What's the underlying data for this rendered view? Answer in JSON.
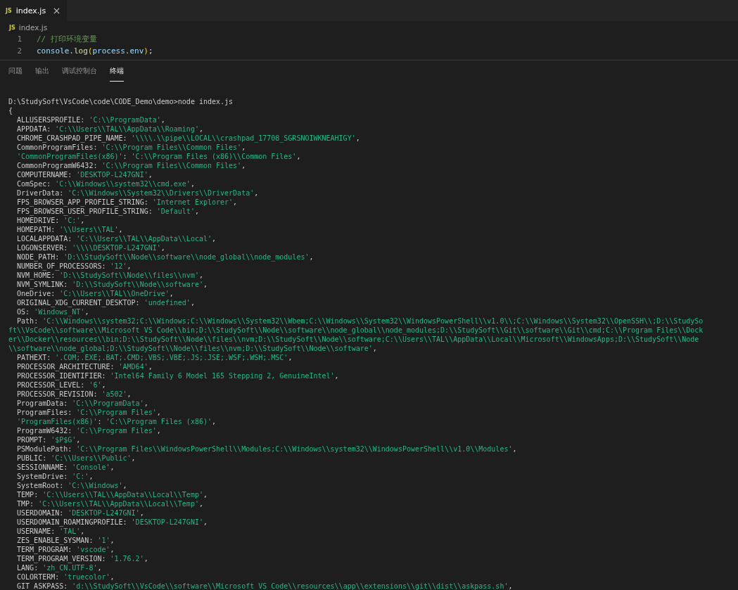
{
  "tabs": [
    {
      "icon_text": "JS",
      "label": "index.js",
      "selected": true
    }
  ],
  "breadcrumb": {
    "icon_text": "JS",
    "label": "index.js"
  },
  "code_lines": [
    {
      "number": "1",
      "tokens": [
        {
          "kind": "comment",
          "text": "// 打印环境变量"
        }
      ]
    },
    {
      "number": "2",
      "tokens": [
        {
          "kind": "variable",
          "text": "console"
        },
        {
          "kind": "punct",
          "text": "."
        },
        {
          "kind": "function",
          "text": "log"
        },
        {
          "kind": "bracket",
          "text": "("
        },
        {
          "kind": "variable",
          "text": "process"
        },
        {
          "kind": "punct",
          "text": "."
        },
        {
          "kind": "variable",
          "text": "env"
        },
        {
          "kind": "bracket",
          "text": ")"
        },
        {
          "kind": "punct",
          "text": ";"
        }
      ]
    }
  ],
  "panel_tabs": [
    {
      "label": "问题",
      "selected": false
    },
    {
      "label": "输出",
      "selected": false
    },
    {
      "label": "调试控制台",
      "selected": false
    },
    {
      "label": "终端",
      "selected": true
    }
  ],
  "terminal": {
    "lines": [
      {
        "kind": "text",
        "text": "D:\\StudySoft\\VsCode\\code\\CODE_Demo\\demo>node index.js"
      },
      {
        "kind": "text",
        "text": "{"
      },
      {
        "kind": "entry",
        "key": "ALLUSERSPROFILE",
        "sep": ":",
        "value": "'C:\\\\ProgramData'",
        "end": ","
      },
      {
        "kind": "entry",
        "key": "APPDATA",
        "sep": ":",
        "value": "'C:\\\\Users\\\\TAL\\\\AppData\\\\Roaming'",
        "end": ","
      },
      {
        "kind": "entry",
        "key": "CHROME_CRASHPAD_PIPE_NAME",
        "sep": ":",
        "value": "'\\\\\\\\.\\\\pipe\\\\LOCAL\\\\crashpad_17708_SGRSNOIWKNEAHIGY'",
        "end": ","
      },
      {
        "kind": "entry",
        "key": "CommonProgramFiles",
        "sep": ":",
        "value": "'C:\\\\Program Files\\\\Common Files'",
        "end": ","
      },
      {
        "kind": "quoted_entry",
        "key": "'CommonProgramFiles(x86)'",
        "sep": ":",
        "value": "'C:\\\\Program Files (x86)\\\\Common Files'",
        "end": ","
      },
      {
        "kind": "entry",
        "key": "CommonProgramW6432",
        "sep": ":",
        "value": "'C:\\\\Program Files\\\\Common Files'",
        "end": ","
      },
      {
        "kind": "entry",
        "key": "COMPUTERNAME",
        "sep": ":",
        "value": "'DESKTOP-L247GNI'",
        "end": ","
      },
      {
        "kind": "entry",
        "key": "ComSpec",
        "sep": ":",
        "value": "'C:\\\\Windows\\\\system32\\\\cmd.exe'",
        "end": ","
      },
      {
        "kind": "entry",
        "key": "DriverData",
        "sep": ":",
        "value": "'C:\\\\Windows\\\\System32\\\\Drivers\\\\DriverData'",
        "end": ","
      },
      {
        "kind": "entry",
        "key": "FPS_BROWSER_APP_PROFILE_STRING",
        "sep": ":",
        "value": "'Internet Explorer'",
        "end": ","
      },
      {
        "kind": "entry",
        "key": "FPS_BROWSER_USER_PROFILE_STRING",
        "sep": ":",
        "value": "'Default'",
        "end": ","
      },
      {
        "kind": "entry",
        "key": "HOMEDRIVE",
        "sep": ":",
        "value": "'C:'",
        "end": ","
      },
      {
        "kind": "entry",
        "key": "HOMEPATH",
        "sep": ":",
        "value": "'\\\\Users\\\\TAL'",
        "end": ","
      },
      {
        "kind": "entry",
        "key": "LOCALAPPDATA",
        "sep": ":",
        "value": "'C:\\\\Users\\\\TAL\\\\AppData\\\\Local'",
        "end": ","
      },
      {
        "kind": "entry",
        "key": "LOGONSERVER",
        "sep": ":",
        "value": "'\\\\\\\\DESKTOP-L247GNI'",
        "end": ","
      },
      {
        "kind": "entry",
        "key": "NODE_PATH",
        "sep": ":",
        "value": "'D:\\\\StudySoft\\\\Node\\\\software\\\\node_global\\\\node_modules'",
        "end": ","
      },
      {
        "kind": "entry",
        "key": "NUMBER_OF_PROCESSORS",
        "sep": ":",
        "value": "'12'",
        "end": ","
      },
      {
        "kind": "entry",
        "key": "NVM_HOME",
        "sep": ":",
        "value": "'D:\\\\StudySoft\\\\Node\\\\files\\\\nvm'",
        "end": ","
      },
      {
        "kind": "entry",
        "key": "NVM_SYMLINK",
        "sep": ":",
        "value": "'D:\\\\StudySoft\\\\Node\\\\software'",
        "end": ","
      },
      {
        "kind": "entry",
        "key": "OneDrive",
        "sep": ":",
        "value": "'C:\\\\Users\\\\TAL\\\\OneDrive'",
        "end": ","
      },
      {
        "kind": "entry",
        "key": "ORIGINAL_XDG_CURRENT_DESKTOP",
        "sep": ":",
        "value": "'undefined'",
        "end": ","
      },
      {
        "kind": "entry",
        "key": "OS",
        "sep": ":",
        "value": "'Windows_NT'",
        "end": ","
      },
      {
        "kind": "entry",
        "key": "Path",
        "sep": ":",
        "value": "'C:\\\\Windows\\\\system32;C:\\\\Windows;C:\\\\Windows\\\\System32\\\\Wbem;C:\\\\Windows\\\\System32\\\\WindowsPowerShell\\\\v1.0\\\\;C:\\\\Windows\\\\System32\\\\OpenSSH\\\\;D:\\\\StudySoft\\\\VsCode\\\\software\\\\Microsoft VS Code\\\\bin;D:\\\\StudySoft\\\\Node\\\\software\\\\node_global\\\\node_modules;D:\\\\StudySoft\\\\Git\\\\software\\\\Git\\\\cmd;C:\\\\Program Files\\\\Docker\\\\Docker\\\\resources\\\\bin;D:\\\\StudySoft\\\\Node\\\\files\\\\nvm;D:\\\\StudySoft\\\\Node\\\\software;C:\\\\Users\\\\TAL\\\\AppData\\\\Local\\\\Microsoft\\\\WindowsApps;D:\\\\StudySoft\\\\Node\\\\software\\\\node_global;D:\\\\StudySoft\\\\Node\\\\files\\\\nvm;D:\\\\StudySoft\\\\Node\\\\software'",
        "end": ","
      },
      {
        "kind": "entry",
        "key": "PATHEXT",
        "sep": ":",
        "value": "'.COM;.EXE;.BAT;.CMD;.VBS;.VBE;.JS;.JSE;.WSF;.WSH;.MSC'",
        "end": ","
      },
      {
        "kind": "entry",
        "key": "PROCESSOR_ARCHITECTURE",
        "sep": ":",
        "value": "'AMD64'",
        "end": ","
      },
      {
        "kind": "entry",
        "key": "PROCESSOR_IDENTIFIER",
        "sep": ":",
        "value": "'Intel64 Family 6 Model 165 Stepping 2, GenuineIntel'",
        "end": ","
      },
      {
        "kind": "entry",
        "key": "PROCESSOR_LEVEL",
        "sep": ":",
        "value": "'6'",
        "end": ","
      },
      {
        "kind": "entry",
        "key": "PROCESSOR_REVISION",
        "sep": ":",
        "value": "'a502'",
        "end": ","
      },
      {
        "kind": "entry",
        "key": "ProgramData",
        "sep": ":",
        "value": "'C:\\\\ProgramData'",
        "end": ","
      },
      {
        "kind": "entry",
        "key": "ProgramFiles",
        "sep": ":",
        "value": "'C:\\\\Program Files'",
        "end": ","
      },
      {
        "kind": "quoted_entry",
        "key": "'ProgramFiles(x86)'",
        "sep": ":",
        "value": "'C:\\\\Program Files (x86)'",
        "end": ","
      },
      {
        "kind": "entry",
        "key": "ProgramW6432",
        "sep": ":",
        "value": "'C:\\\\Program Files'",
        "end": ","
      },
      {
        "kind": "entry",
        "key": "PROMPT",
        "sep": ":",
        "value": "'$P$G'",
        "end": ","
      },
      {
        "kind": "entry",
        "key": "PSModulePath",
        "sep": ":",
        "value": "'C:\\\\Program Files\\\\WindowsPowerShell\\\\Modules;C:\\\\Windows\\\\system32\\\\WindowsPowerShell\\\\v1.0\\\\Modules'",
        "end": ","
      },
      {
        "kind": "entry",
        "key": "PUBLIC",
        "sep": ":",
        "value": "'C:\\\\Users\\\\Public'",
        "end": ","
      },
      {
        "kind": "entry",
        "key": "SESSIONNAME",
        "sep": ":",
        "value": "'Console'",
        "end": ","
      },
      {
        "kind": "entry",
        "key": "SystemDrive",
        "sep": ":",
        "value": "'C:'",
        "end": ","
      },
      {
        "kind": "entry",
        "key": "SystemRoot",
        "sep": ":",
        "value": "'C:\\\\Windows'",
        "end": ","
      },
      {
        "kind": "entry",
        "key": "TEMP",
        "sep": ":",
        "value": "'C:\\\\Users\\\\TAL\\\\AppData\\\\Local\\\\Temp'",
        "end": ","
      },
      {
        "kind": "entry",
        "key": "TMP",
        "sep": ":",
        "value": "'C:\\\\Users\\\\TAL\\\\AppData\\\\Local\\\\Temp'",
        "end": ","
      },
      {
        "kind": "entry",
        "key": "USERDOMAIN",
        "sep": ":",
        "value": "'DESKTOP-L247GNI'",
        "end": ","
      },
      {
        "kind": "entry",
        "key": "USERDOMAIN_ROAMINGPROFILE",
        "sep": ":",
        "value": "'DESKTOP-L247GNI'",
        "end": ","
      },
      {
        "kind": "entry",
        "key": "USERNAME",
        "sep": ":",
        "value": "'TAL'",
        "end": ","
      },
      {
        "kind": "entry",
        "key": "ZES_ENABLE_SYSMAN",
        "sep": ":",
        "value": "'1'",
        "end": ","
      },
      {
        "kind": "entry",
        "key": "TERM_PROGRAM",
        "sep": ":",
        "value": "'vscode'",
        "end": ","
      },
      {
        "kind": "entry",
        "key": "TERM_PROGRAM_VERSION",
        "sep": ":",
        "value": "'1.76.2'",
        "end": ","
      },
      {
        "kind": "entry",
        "key": "LANG",
        "sep": ":",
        "value": "'zh_CN.UTF-8'",
        "end": ","
      },
      {
        "kind": "entry",
        "key": "COLORTERM",
        "sep": ":",
        "value": "'truecolor'",
        "end": ","
      },
      {
        "kind": "entry",
        "key": "GIT_ASKPASS",
        "sep": ":",
        "value": "'d:\\\\StudySoft\\\\VsCode\\\\software\\\\Microsoft VS Code\\\\resources\\\\app\\\\extensions\\\\git\\\\dist\\\\askpass.sh'",
        "end": ","
      }
    ]
  }
}
